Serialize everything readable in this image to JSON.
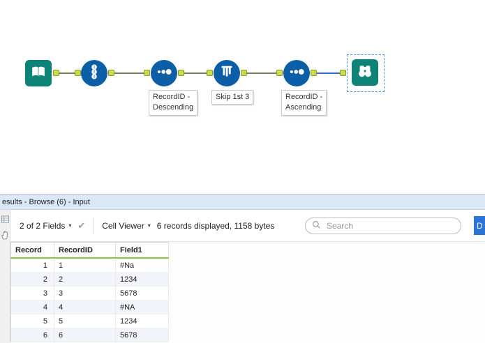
{
  "canvas": {
    "annotations": {
      "sort_desc": "RecordID -\nDescending",
      "sample": "Skip 1st 3",
      "sort_asc": "RecordID -\nAscending"
    }
  },
  "results": {
    "title": "esults - Browse (6) - Input",
    "toolbar": {
      "fields_dropdown": "2 of 2 Fields",
      "cell_viewer_dropdown": "Cell Viewer",
      "records_info": "6 records displayed, 1158 bytes",
      "search_placeholder": "Search",
      "action_button": "D"
    },
    "table": {
      "columns": [
        "Record",
        "RecordID",
        "Field1"
      ],
      "rows": [
        [
          "1",
          "1",
          "#Na"
        ],
        [
          "2",
          "2",
          "1234"
        ],
        [
          "3",
          "3",
          "5678"
        ],
        [
          "4",
          "4",
          "#NA"
        ],
        [
          "5",
          "5",
          "1234"
        ],
        [
          "6",
          "6",
          "5678"
        ]
      ]
    }
  },
  "icons": {
    "input_data": "open-book",
    "record_id": "numbered-circles-1-2-3",
    "sort": "three-dots",
    "sample": "test-tubes",
    "browse": "binoculars",
    "search": "magnifier",
    "caret": "▾",
    "check": "✔"
  },
  "colors": {
    "tool_teal": "#0d8276",
    "tool_blue": "#0c5fa6",
    "anchor_green": "#cbdb4b",
    "wire_green": "#6f7f52",
    "wire_selected_blue": "#2e6bc6",
    "results_header_bg": "#d9e7f6",
    "table_header_underline": "#8dc63f",
    "action_button_blue": "#2b74d8"
  }
}
